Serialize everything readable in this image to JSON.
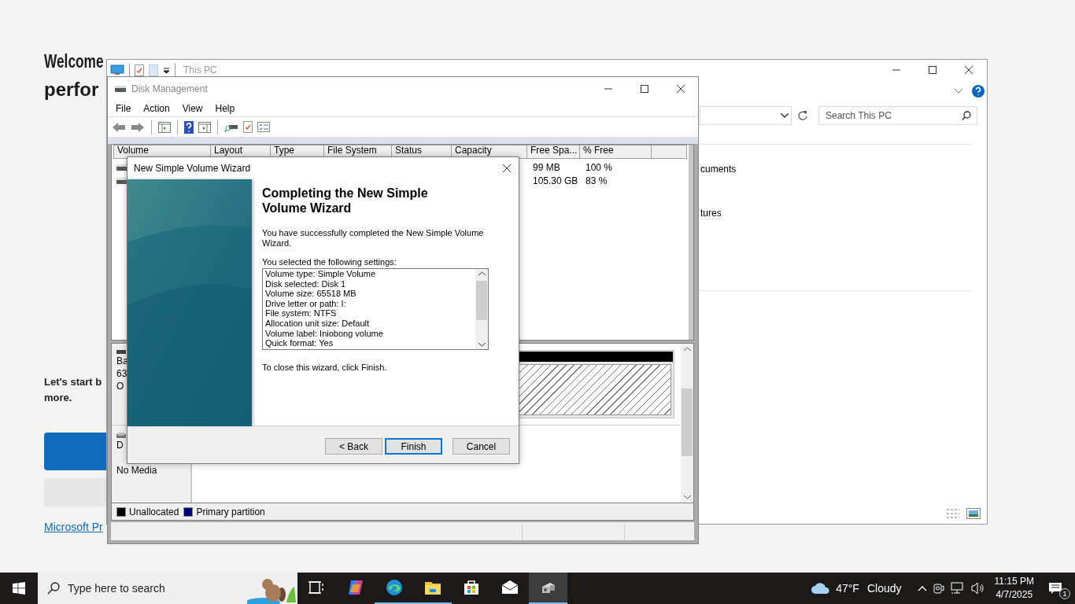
{
  "edge_page": {
    "heading_lines": [
      "Welcome",
      "perfor"
    ],
    "intro_lines": [
      "Let's start b",
      "more."
    ],
    "link": "Microsoft Pr"
  },
  "explorer": {
    "title": "This PC",
    "search": {
      "placeholder": "Search This PC"
    },
    "items": [
      "cuments",
      "tures"
    ]
  },
  "disk_management": {
    "title": "Disk Management",
    "menu": [
      "File",
      "Action",
      "View",
      "Help"
    ],
    "columns": [
      "Volume",
      "Layout",
      "Type",
      "File System",
      "Status",
      "Capacity",
      "Free Spa...",
      "% Free"
    ],
    "rows": [
      {
        "free_space": "99 MB",
        "percent_free": "100 %"
      },
      {
        "free_space": "105.30 GB",
        "percent_free": "83 %"
      }
    ],
    "disks": [
      {
        "kind": "disk",
        "label_lines": [
          "Ba",
          "63",
          "O"
        ]
      },
      {
        "kind": "dvd",
        "label_lines": [
          "D",
          "No Media"
        ]
      }
    ],
    "legend": [
      {
        "label": "Unallocated",
        "color": "#000000"
      },
      {
        "label": "Primary partition",
        "color": "#000080"
      }
    ]
  },
  "wizard": {
    "title": "New Simple Volume Wizard",
    "heading": "Completing the New Simple Volume Wizard",
    "intro": "You have successfully completed the New Simple Volume Wizard.",
    "settings_label": "You selected the following settings:",
    "settings": [
      "Volume type: Simple Volume",
      "Disk selected: Disk 1",
      "Volume size: 65518 MB",
      "Drive letter or path: I:",
      "File system: NTFS",
      "Allocation unit size: Default",
      "Volume label: Iniobong volume",
      "Quick format: Yes"
    ],
    "closing_note": "To close this wizard, click Finish.",
    "buttons": [
      {
        "label": "< Back",
        "focused": false
      },
      {
        "label": "Finish",
        "focused": true
      },
      {
        "label": "Cancel",
        "focused": false
      }
    ]
  },
  "taskbar": {
    "search": {
      "placeholder": "Type here to search"
    },
    "apps": [
      {
        "kind": "task-view",
        "running": false,
        "active": false
      },
      {
        "kind": "copilot",
        "running": false,
        "active": false
      },
      {
        "kind": "edge",
        "running": true,
        "active": false
      },
      {
        "kind": "file-explorer",
        "running": true,
        "active": false
      },
      {
        "kind": "store",
        "running": false,
        "active": false
      },
      {
        "kind": "mail",
        "running": false,
        "active": false
      },
      {
        "kind": "disk-management",
        "running": true,
        "active": true
      }
    ],
    "weather": {
      "temperature": "47°F",
      "condition": "Cloudy"
    },
    "time": "11:15 PM",
    "date": "4/7/2025",
    "notifications": "1"
  }
}
